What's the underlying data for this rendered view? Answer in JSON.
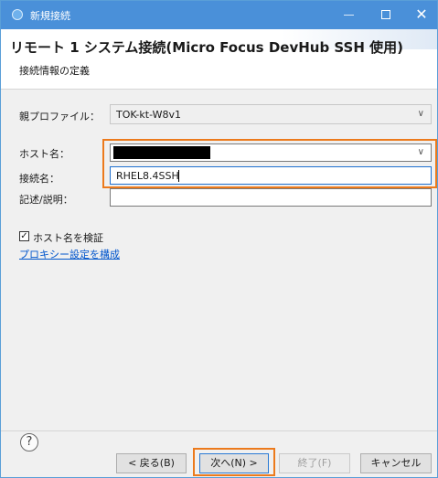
{
  "window": {
    "title": "新規接続"
  },
  "header": {
    "title": "リモート 1 システム接続(Micro Focus DevHub SSH 使用)",
    "subtitle": "接続情報の定義"
  },
  "form": {
    "parent_profile": {
      "label": "親プロファイル：",
      "value": "TOK-kt-W8v1"
    },
    "host_name": {
      "label": "ホスト名：",
      "value": ""
    },
    "connection_name": {
      "label": "接続名：",
      "value": "RHEL8.4SSH"
    },
    "description": {
      "label": "記述/説明：",
      "value": ""
    },
    "verify_host": {
      "label": "ホスト名を検証",
      "checked": true,
      "mark": "✓"
    },
    "proxy_link": "プロキシー設定を構成"
  },
  "footer": {
    "help_symbol": "?",
    "back": "< 戻る(B)",
    "next": "次へ(N) >",
    "finish": "終了(F)",
    "cancel": "キャンセル"
  },
  "colors": {
    "titlebar": "#4a90d9",
    "highlight": "#ec7a1c",
    "link": "#0055cc"
  }
}
